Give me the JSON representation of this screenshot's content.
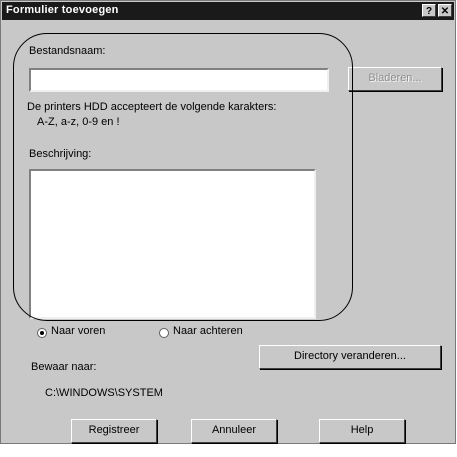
{
  "window": {
    "title": "Formulier toevoegen",
    "help_button": "?",
    "close_button": "✕"
  },
  "filename": {
    "label": "Bestandsnaam:",
    "value": "",
    "browse_button": "Bladeren..."
  },
  "info": {
    "line1": "De printers HDD accepteert de volgende karakters:",
    "line2": "A-Z, a-z, 0-9 en !"
  },
  "description": {
    "label": "Beschrijving:",
    "value": ""
  },
  "position": {
    "options": [
      "Naar voren",
      "Naar achteren"
    ],
    "selected": "Naar voren"
  },
  "save_to": {
    "label": "Bewaar naar:",
    "path": "C:\\WINDOWS\\SYSTEM",
    "change_directory_button": "Directory veranderen..."
  },
  "actions": {
    "register": "Registreer",
    "cancel": "Annuleer",
    "help": "Help"
  }
}
